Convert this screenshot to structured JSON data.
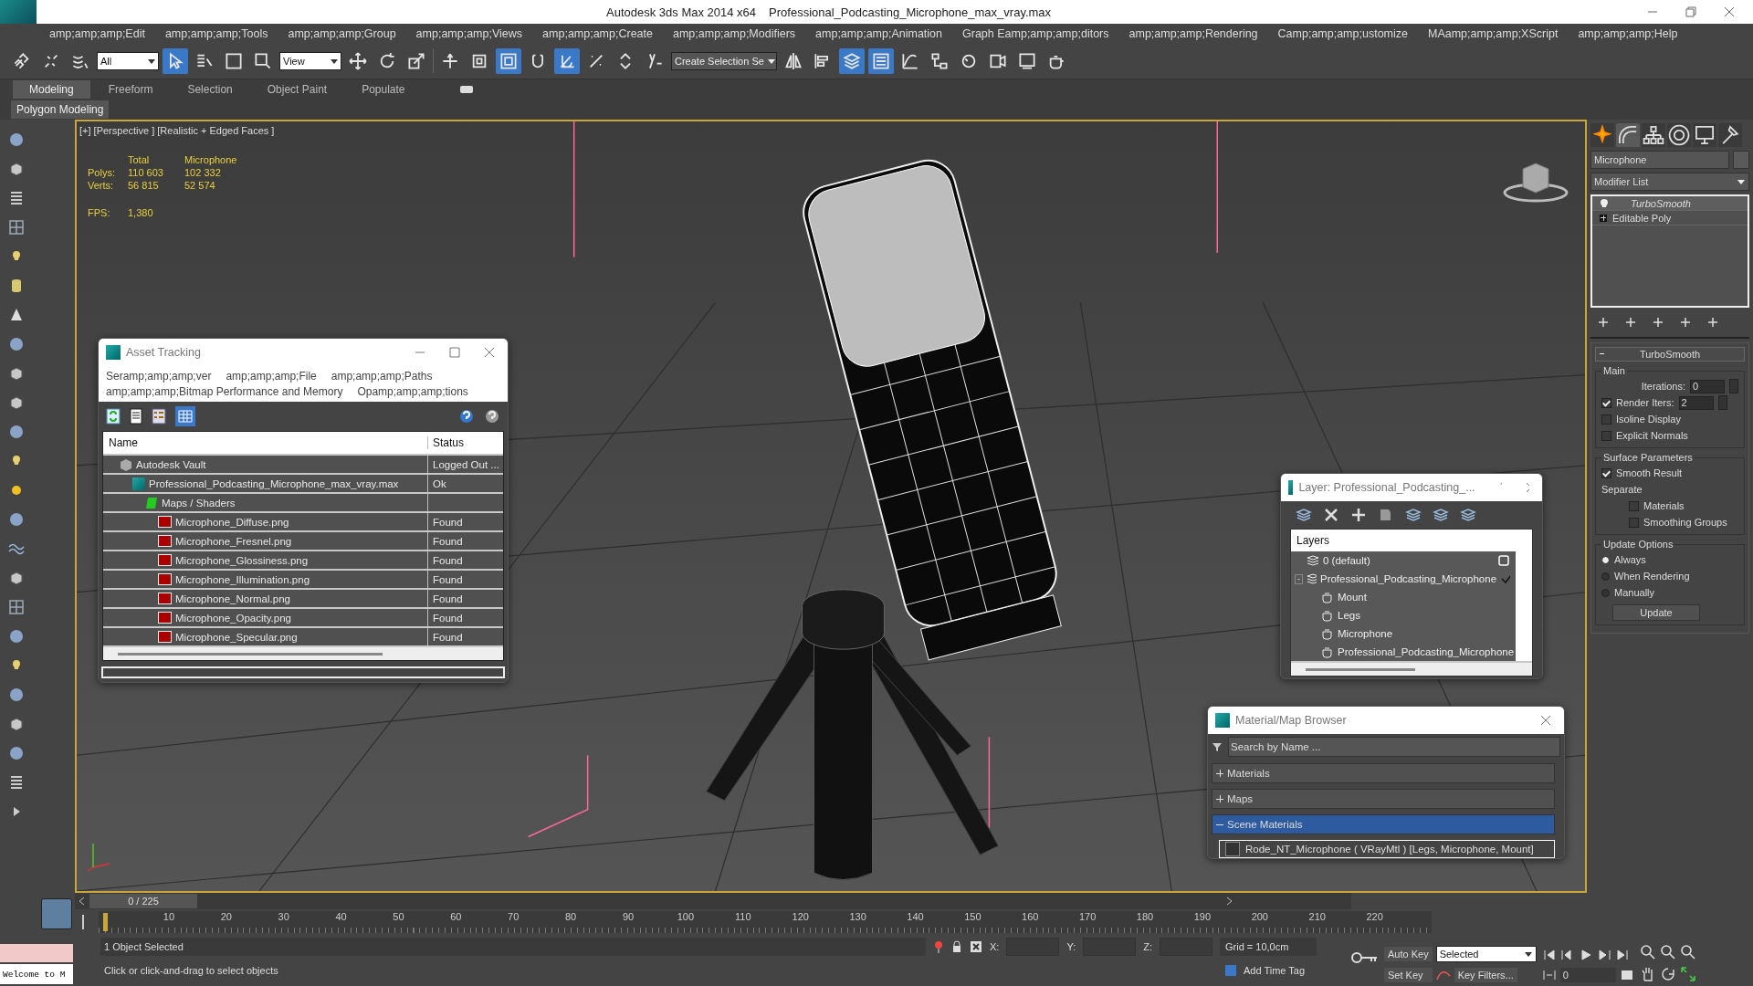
{
  "window": {
    "app": "Autodesk 3ds Max  2014 x64",
    "file": "Professional_Podcasting_Microphone_max_vray.max"
  },
  "menu": [
    "amp;amp;amp;Edit",
    "amp;amp;amp;Tools",
    "amp;amp;amp;Group",
    "amp;amp;amp;Views",
    "amp;amp;amp;Create",
    "amp;amp;amp;Modifiers",
    "amp;amp;amp;Animation",
    "Graph Eamp;amp;amp;ditors",
    "amp;amp;amp;Rendering",
    "Camp;amp;amp;ustomize",
    "MAamp;amp;amp;XScript",
    "amp;amp;amp;Help"
  ],
  "toolbar": {
    "selection_filter": "All",
    "reference_coord": "View",
    "named_selection": "Create Selection Se",
    "buttons": [
      {
        "kind": "link",
        "active": false
      },
      {
        "kind": "unlink",
        "active": false
      },
      {
        "kind": "bind",
        "active": false
      },
      {
        "kind": "filter"
      },
      {
        "kind": "cursor",
        "active": true
      },
      {
        "kind": "list",
        "active": false
      },
      {
        "kind": "region",
        "active": false
      },
      {
        "kind": "window",
        "active": false
      },
      {
        "kind": "filter"
      },
      {
        "kind": "move",
        "active": false
      },
      {
        "kind": "rotate",
        "active": false
      },
      {
        "kind": "scale",
        "active": false
      },
      {
        "kind": "coord"
      },
      {
        "kind": "pivot",
        "active": false
      },
      {
        "kind": "manipulate",
        "active": false
      },
      {
        "kind": "frame",
        "active": true
      },
      {
        "kind": "snap",
        "active": false
      },
      {
        "kind": "angle",
        "active": true
      },
      {
        "kind": "percent",
        "active": false
      },
      {
        "kind": "spinner",
        "active": false
      },
      {
        "kind": "abc",
        "active": false
      },
      {
        "kind": "named"
      },
      {
        "kind": "mirror",
        "active": false
      },
      {
        "kind": "align",
        "active": false
      },
      {
        "kind": "layers",
        "active": true
      },
      {
        "kind": "explorer",
        "active": true
      },
      {
        "kind": "curve",
        "active": false
      },
      {
        "kind": "schematic",
        "active": false
      },
      {
        "kind": "material",
        "active": false
      },
      {
        "kind": "setup",
        "active": false
      },
      {
        "kind": "frame2",
        "active": false
      },
      {
        "kind": "teapot",
        "active": false
      }
    ]
  },
  "ribbon_tabs": [
    {
      "label": "Modeling",
      "selected": true
    },
    {
      "label": "Freeform",
      "selected": false
    },
    {
      "label": "Selection",
      "selected": false
    },
    {
      "label": "Object Paint",
      "selected": false
    },
    {
      "label": "Populate",
      "selected": false
    }
  ],
  "ribbon_panel": "Polygon Modeling",
  "viewport": {
    "label": "[+] [Perspective ] [Realistic + Edged Faces ]",
    "stat_headers": [
      "Total",
      "Microphone"
    ],
    "stats": [
      {
        "label": "Polys:",
        "total": "110 603",
        "object": "102 332"
      },
      {
        "label": "Verts:",
        "total": "56 815",
        "object": "52 574"
      }
    ],
    "fps_label": "FPS:",
    "fps": "1,380"
  },
  "asset_tracking": {
    "title": "Asset Tracking",
    "menu": [
      "Seramp;amp;amp;ver",
      "amp;amp;amp;File",
      "amp;amp;amp;Paths",
      "amp;amp;amp;Bitmap Performance and Memory",
      "Opamp;amp;amp;tions"
    ],
    "columns": [
      "Name",
      "Status"
    ],
    "rows": [
      {
        "name": "Autodesk Vault",
        "kind": "vault",
        "status": "Logged Out ...",
        "children": [
          {
            "name": "Professional_Podcasting_Microphone_max_vray.max",
            "kind": "max",
            "status": "Ok",
            "children": [
              {
                "name": "Maps / Shaders",
                "kind": "folder",
                "children": [
                  {
                    "name": "Microphone_Diffuse.png",
                    "kind": "png",
                    "status": "Found"
                  },
                  {
                    "name": "Microphone_Fresnel.png",
                    "kind": "png",
                    "status": "Found"
                  },
                  {
                    "name": "Microphone_Glossiness.png",
                    "kind": "png",
                    "status": "Found"
                  },
                  {
                    "name": "Microphone_Illumination.png",
                    "kind": "png",
                    "status": "Found"
                  },
                  {
                    "name": "Microphone_Normal.png",
                    "kind": "png",
                    "status": "Found"
                  },
                  {
                    "name": "Microphone_Opacity.png",
                    "kind": "png",
                    "status": "Found"
                  },
                  {
                    "name": "Microphone_Specular.png",
                    "kind": "png",
                    "status": "Found"
                  }
                ]
              }
            ]
          }
        ]
      }
    ]
  },
  "layer_explorer": {
    "title": "Layer: Professional_Podcasting_...",
    "header": "Layers",
    "layers": [
      {
        "name": "0 (default)",
        "kind": "layer",
        "current": false
      },
      {
        "name": "Professional_Podcasting_Microphone",
        "kind": "layer",
        "current": true,
        "expanded": true,
        "children": [
          {
            "name": "Mount",
            "kind": "object"
          },
          {
            "name": "Legs",
            "kind": "object"
          },
          {
            "name": "Microphone",
            "kind": "object"
          },
          {
            "name": "Professional_Podcasting_Microphone",
            "kind": "object"
          }
        ]
      }
    ]
  },
  "material_browser": {
    "title": "Material/Map Browser",
    "search_placeholder": "Search by Name ...",
    "groups": [
      {
        "label": "Materials",
        "expanded": false
      },
      {
        "label": "Maps",
        "expanded": false
      },
      {
        "label": "Scene Materials",
        "expanded": true,
        "items": [
          {
            "label": "Rode_NT_Microphone  ( VRayMtl ) [Legs, Microphone, Mount]",
            "selected": true
          }
        ]
      }
    ]
  },
  "command_panel": {
    "tabs": [
      {
        "kind": "create",
        "selected": false
      },
      {
        "kind": "modify",
        "selected": true
      },
      {
        "kind": "hierarchy",
        "selected": false
      },
      {
        "kind": "motion",
        "selected": false
      },
      {
        "kind": "display",
        "selected": false
      },
      {
        "kind": "utilities",
        "selected": false
      }
    ],
    "object_name": "Microphone",
    "modifier_list": "Modifier List",
    "stack": [
      {
        "label": "TurboSmooth",
        "kind": "modifier"
      },
      {
        "label": "Editable Poly",
        "kind": "base"
      }
    ],
    "rollout": {
      "title": "TurboSmooth",
      "main": "Main",
      "iterations_label": "Iterations:",
      "iterations": "0",
      "render_iters": {
        "label": "Render Iters:",
        "checked": true,
        "value": "2"
      },
      "main_options": [
        {
          "label": "Isoline Display",
          "checked": false
        },
        {
          "label": "Explicit Normals",
          "checked": false
        }
      ],
      "surface": "Surface Parameters",
      "smooth_result": {
        "label": "Smooth Result",
        "checked": true
      },
      "separate": "Separate",
      "separate_options": [
        {
          "label": "Materials",
          "checked": false
        },
        {
          "label": "Smoothing Groups",
          "checked": false
        }
      ],
      "update_options": "Update Options",
      "update_modes": [
        {
          "label": "Always",
          "selected": true
        },
        {
          "label": "When Rendering",
          "selected": false
        },
        {
          "label": "Manually",
          "selected": false
        }
      ],
      "update_button": "Update"
    }
  },
  "timeline": {
    "frame": "0 / 225",
    "ticks": [
      "10",
      "20",
      "30",
      "40",
      "50",
      "60",
      "70",
      "80",
      "90",
      "100",
      "110",
      "120",
      "130",
      "140",
      "150",
      "160",
      "170",
      "180",
      "190",
      "200",
      "210",
      "220"
    ]
  },
  "status_bar": {
    "maxscript": "Welcome to M",
    "selection": "1 Object Selected",
    "prompt": "Click or click-and-drag to select objects",
    "x_label": "X:",
    "y_label": "Y:",
    "z_label": "Z:",
    "grid": "Grid = 10,0cm",
    "add_time_tag": "Add Time Tag",
    "auto_key": "Auto Key",
    "set_key": "Set Key",
    "key_mode": "Selected",
    "key_filters": "Key Filters...",
    "frame": "0"
  }
}
